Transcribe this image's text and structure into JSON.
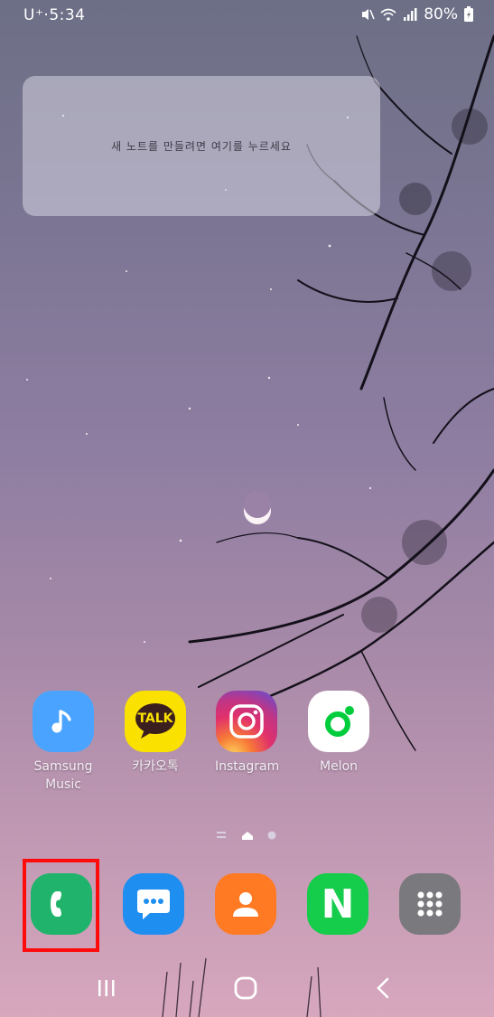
{
  "status_bar": {
    "carrier_time": "U⁺·5:34",
    "battery": "80%",
    "icons": [
      "mute-vibrate-icon",
      "wifi-icon",
      "signal-icon",
      "battery-charging-icon"
    ]
  },
  "note_widget": {
    "placeholder": "새 노트를 만들려면 여기를 누르세요"
  },
  "home_apps": [
    {
      "name": "Samsung Music",
      "label": "Samsung\nMusic",
      "color": "#4aa4ff"
    },
    {
      "name": "KakaoTalk",
      "label": "카카오톡",
      "color": "#fae100"
    },
    {
      "name": "Instagram",
      "label": "Instagram",
      "color": "#e1306c"
    },
    {
      "name": "Melon",
      "label": "Melon",
      "color": "#00cd3c"
    }
  ],
  "kakao_icon_text": "TALK",
  "pager": {
    "pages": [
      "menu-page",
      "home-page",
      "page-2"
    ],
    "current": "home-page"
  },
  "dock": [
    {
      "name": "Phone",
      "icon": "phone-icon",
      "color": "#1fb36b"
    },
    {
      "name": "Messages",
      "icon": "messages-icon",
      "color": "#1e8ff0"
    },
    {
      "name": "Contacts",
      "icon": "contacts-icon",
      "color": "#ff7a22"
    },
    {
      "name": "Naver",
      "icon": "naver-icon",
      "color": "#15cc4b"
    },
    {
      "name": "Apps",
      "icon": "apps-grid-icon",
      "color": "#7a7a7e"
    }
  ],
  "naver_letter": "N",
  "navbar": {
    "buttons": [
      "recent-apps-button",
      "home-button",
      "back-button"
    ]
  }
}
